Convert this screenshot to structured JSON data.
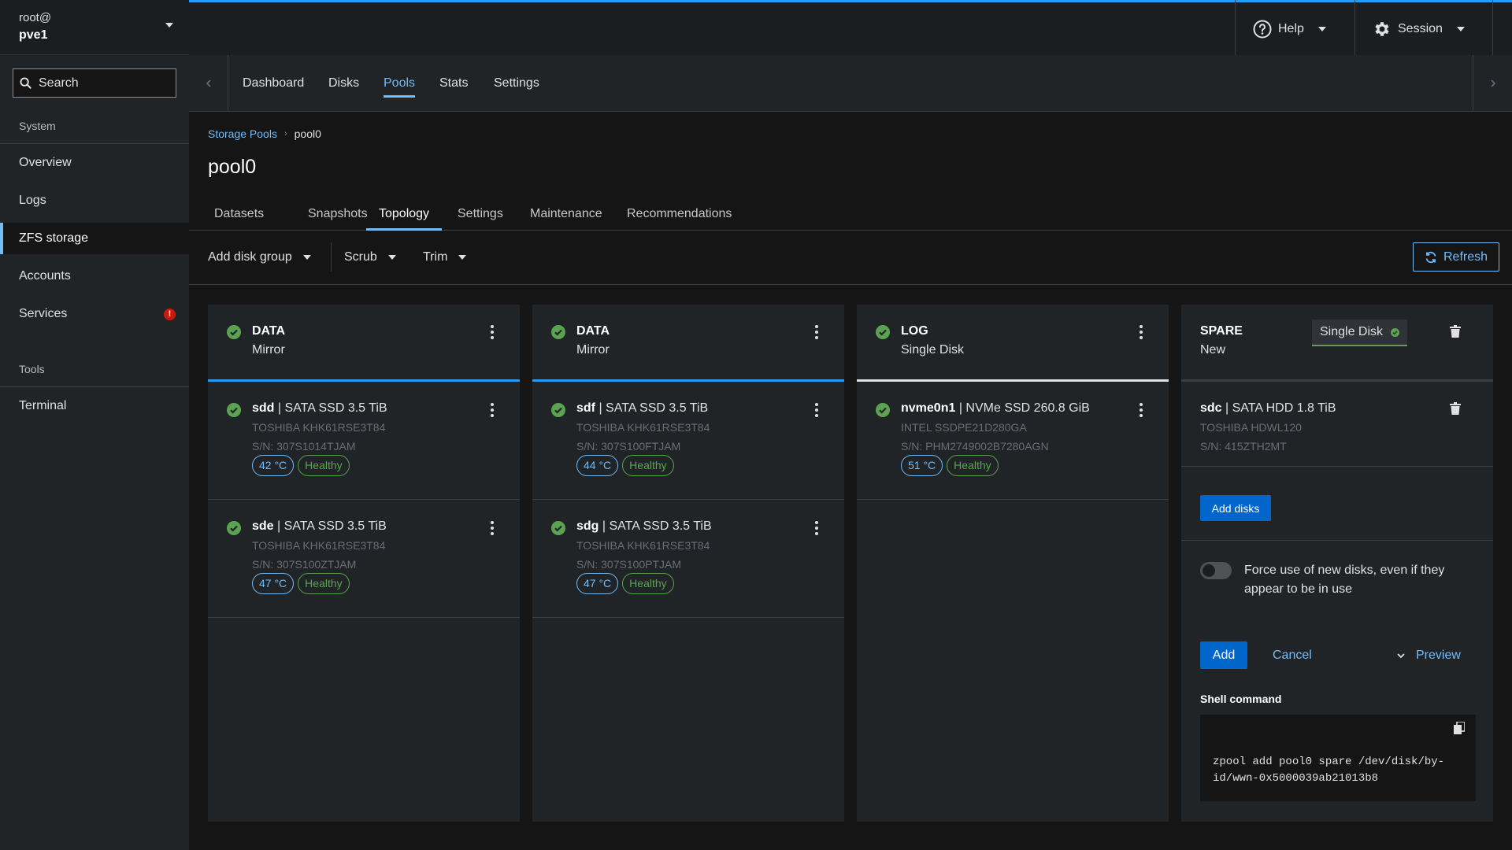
{
  "sidebar": {
    "user": "root@",
    "host": "pve1",
    "search_placeholder": "Search",
    "sections": [
      {
        "label": "System"
      },
      {
        "label": "Tools"
      }
    ],
    "items": [
      {
        "label": "Overview"
      },
      {
        "label": "Logs"
      },
      {
        "label": "ZFS storage",
        "active": true
      },
      {
        "label": "Accounts"
      },
      {
        "label": "Services",
        "badge": "!"
      },
      {
        "label": "Terminal"
      }
    ]
  },
  "topbar": {
    "help_label": "Help",
    "session_label": "Session"
  },
  "primary_tabs": [
    {
      "label": "Dashboard"
    },
    {
      "label": "Disks"
    },
    {
      "label": "Pools",
      "active": true
    },
    {
      "label": "Stats"
    },
    {
      "label": "Settings"
    }
  ],
  "breadcrumb": {
    "parent": "Storage Pools",
    "current": "pool0"
  },
  "page_title": "pool0",
  "sub_tabs": [
    {
      "label": "Datasets"
    },
    {
      "label": "Snapshots"
    },
    {
      "label": "Topology",
      "active": true
    },
    {
      "label": "Settings"
    },
    {
      "label": "Maintenance"
    },
    {
      "label": "Recommendations"
    }
  ],
  "toolbar": {
    "add_disk_group": "Add disk group",
    "scrub": "Scrub",
    "trim": "Trim",
    "refresh": "Refresh"
  },
  "groups": [
    {
      "title": "DATA",
      "subtitle": "Mirror",
      "disks": [
        {
          "name": "sdd",
          "desc": " | SATA SSD 3.5 TiB",
          "model": "TOSHIBA KHK61RSE3T84",
          "sn": "S/N: 307S1014TJAM",
          "temp": "42 °C",
          "health": "Healthy"
        },
        {
          "name": "sde",
          "desc": " | SATA SSD 3.5 TiB",
          "model": "TOSHIBA KHK61RSE3T84",
          "sn": "S/N: 307S100ZTJAM",
          "temp": "47 °C",
          "health": "Healthy"
        }
      ]
    },
    {
      "title": "DATA",
      "subtitle": "Mirror",
      "disks": [
        {
          "name": "sdf",
          "desc": " | SATA SSD 3.5 TiB",
          "model": "TOSHIBA KHK61RSE3T84",
          "sn": "S/N: 307S100FTJAM",
          "temp": "44 °C",
          "health": "Healthy"
        },
        {
          "name": "sdg",
          "desc": " | SATA SSD 3.5 TiB",
          "model": "TOSHIBA KHK61RSE3T84",
          "sn": "S/N: 307S100PTJAM",
          "temp": "47 °C",
          "health": "Healthy"
        }
      ]
    },
    {
      "title": "LOG",
      "subtitle": "Single Disk",
      "disks": [
        {
          "name": "nvme0n1",
          "desc": " | NVMe SSD 260.8 GiB",
          "model": "INTEL SSDPE21D280GA",
          "sn": "S/N: PHM2749002B7280AGN",
          "temp": "51 °C",
          "health": "Healthy"
        }
      ]
    }
  ],
  "spare": {
    "title": "SPARE",
    "subtitle": "New",
    "layout_select": "Single Disk",
    "disk": {
      "name": "sdc",
      "desc": " | SATA HDD 1.8 TiB",
      "model": "TOSHIBA HDWL120",
      "sn": "S/N: 415ZTH2MT"
    },
    "add_disks_label": "Add disks",
    "force_label": "Force use of new disks, even if they appear to be in use",
    "force_enabled": false,
    "add_label": "Add",
    "cancel_label": "Cancel",
    "preview_label": "Preview",
    "shell_label": "Shell command",
    "shell_command": "zpool add pool0 spare /dev/disk/by-id/wwn-0x5000039ab21013b8"
  },
  "colors": {
    "accent": "#73bcf7",
    "primary": "#0066cc",
    "success": "#5ba352",
    "danger": "#c9190b"
  }
}
